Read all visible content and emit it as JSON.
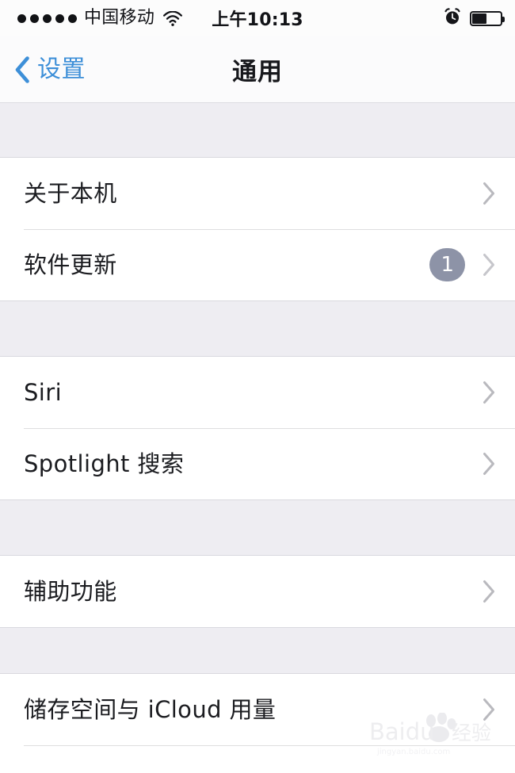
{
  "status_bar": {
    "signal_dots": 5,
    "signal_dots_filled": 5,
    "carrier": "中国移动",
    "wifi_icon": "wifi-icon",
    "time": "上午10:13",
    "alarm_icon": "alarm-clock-icon",
    "battery_icon": "battery-icon",
    "battery_percent": 48
  },
  "nav": {
    "back_icon": "chevron-left-icon",
    "back_label": "设置",
    "title": "通用",
    "back_color": "#3d8fd8",
    "title_color": "#17181c"
  },
  "sections": [
    {
      "rows": [
        {
          "label": "关于本机",
          "badge": null,
          "disclosure_icon": "chevron-right-icon"
        },
        {
          "label": "软件更新",
          "badge": "1",
          "disclosure_icon": "chevron-right-icon"
        }
      ]
    },
    {
      "rows": [
        {
          "label": "Siri",
          "badge": null,
          "disclosure_icon": "chevron-right-icon"
        },
        {
          "label": "Spotlight 搜索",
          "badge": null,
          "disclosure_icon": "chevron-right-icon"
        }
      ]
    },
    {
      "rows": [
        {
          "label": "辅助功能",
          "badge": null,
          "disclosure_icon": "chevron-right-icon"
        }
      ]
    },
    {
      "rows": [
        {
          "label": "储存空间与 iCloud 用量",
          "badge": null,
          "disclosure_icon": "chevron-right-icon"
        }
      ]
    }
  ],
  "watermark": {
    "text": "Baidu 经验",
    "icon": "baidu-paw-icon"
  },
  "colors": {
    "accent_blue": "#3d8fd8",
    "group_background": "#eeedf2",
    "row_background": "#ffffff",
    "separator": "#dededf",
    "badge_background": "#8d93a7",
    "chevron_gray": "#b9b9be"
  }
}
